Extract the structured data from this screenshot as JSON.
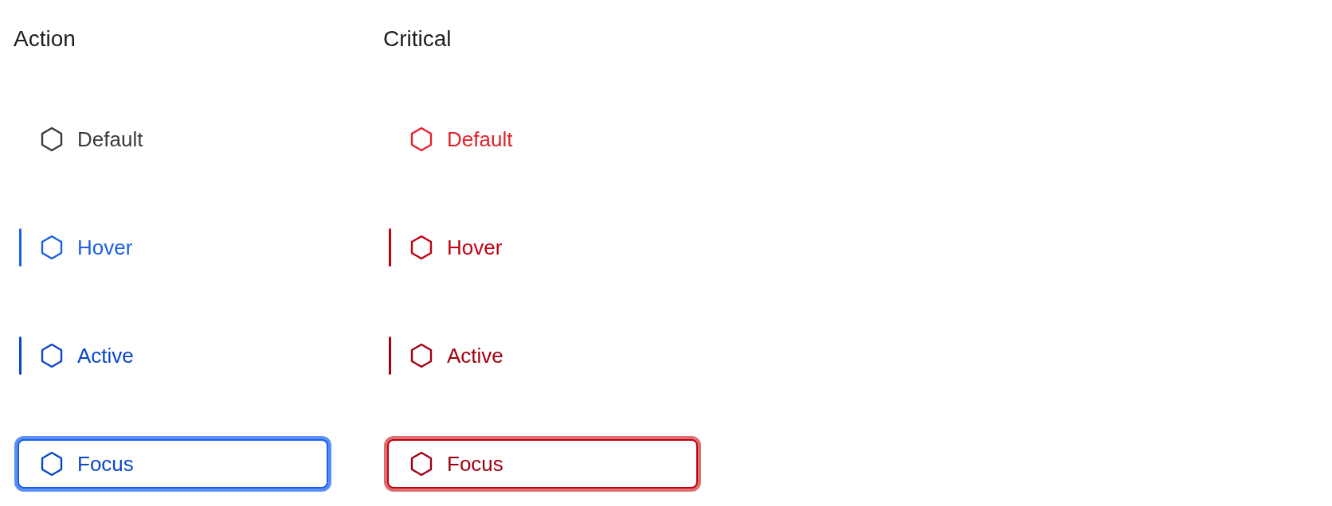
{
  "columns": [
    {
      "kind": "action",
      "title": "Action",
      "items": [
        {
          "label": "Default",
          "kind": "default"
        },
        {
          "label": "Hover",
          "kind": "hover"
        },
        {
          "label": "Active",
          "kind": "active"
        },
        {
          "label": "Focus",
          "kind": "focus"
        }
      ]
    },
    {
      "kind": "critical",
      "title": "Critical",
      "items": [
        {
          "label": "Default",
          "kind": "default"
        },
        {
          "label": "Hover",
          "kind": "hover"
        },
        {
          "label": "Active",
          "kind": "active"
        },
        {
          "label": "Focus",
          "kind": "focus"
        }
      ]
    }
  ]
}
